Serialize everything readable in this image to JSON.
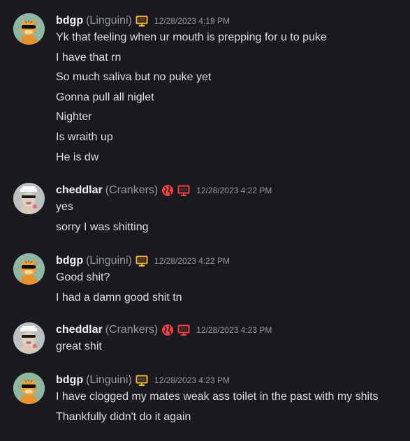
{
  "colors": {
    "background": "#1a1a1e",
    "username": "#f2f3f5",
    "muted": "#949ba4",
    "message": "#dbdee1",
    "monitor_orange": "#f0b232",
    "monitor_red": "#f23f43",
    "globe_red": "#ed4245"
  },
  "groups": [
    {
      "avatar": "garfield-avatar",
      "username": "bdgp",
      "nickname": "(Linguini)",
      "badges": [
        "monitor-icon-orange"
      ],
      "timestamp": "12/28/2023 4:19 PM",
      "messages": [
        "Yk that feeling when ur mouth is prepping for u to puke",
        "I have that rn",
        "So much saliva but no puke yet",
        "Gonna pull all niglet",
        "Nighter",
        "Is wraith up",
        "He is dw"
      ]
    },
    {
      "avatar": "cheddlar-avatar",
      "username": "cheddlar",
      "nickname": "(Crankers)",
      "badges": [
        "globe-icon",
        "monitor-icon-red"
      ],
      "timestamp": "12/28/2023 4:22 PM",
      "messages": [
        "yes",
        "sorry I was shitting"
      ]
    },
    {
      "avatar": "garfield-avatar",
      "username": "bdgp",
      "nickname": "(Linguini)",
      "badges": [
        "monitor-icon-orange"
      ],
      "timestamp": "12/28/2023 4:22 PM",
      "messages": [
        "Good shit?",
        "I had a damn good shit tn"
      ]
    },
    {
      "avatar": "cheddlar-avatar",
      "username": "cheddlar",
      "nickname": "(Crankers)",
      "badges": [
        "globe-icon",
        "monitor-icon-red"
      ],
      "timestamp": "12/28/2023 4:23 PM",
      "messages": [
        "great shit"
      ]
    },
    {
      "avatar": "garfield-avatar",
      "username": "bdgp",
      "nickname": "(Linguini)",
      "badges": [
        "monitor-icon-orange"
      ],
      "timestamp": "12/28/2023 4:23 PM",
      "messages": [
        "I have clogged my mates weak ass toilet in the past with my shits",
        "Thankfully didn't do it again"
      ]
    }
  ]
}
